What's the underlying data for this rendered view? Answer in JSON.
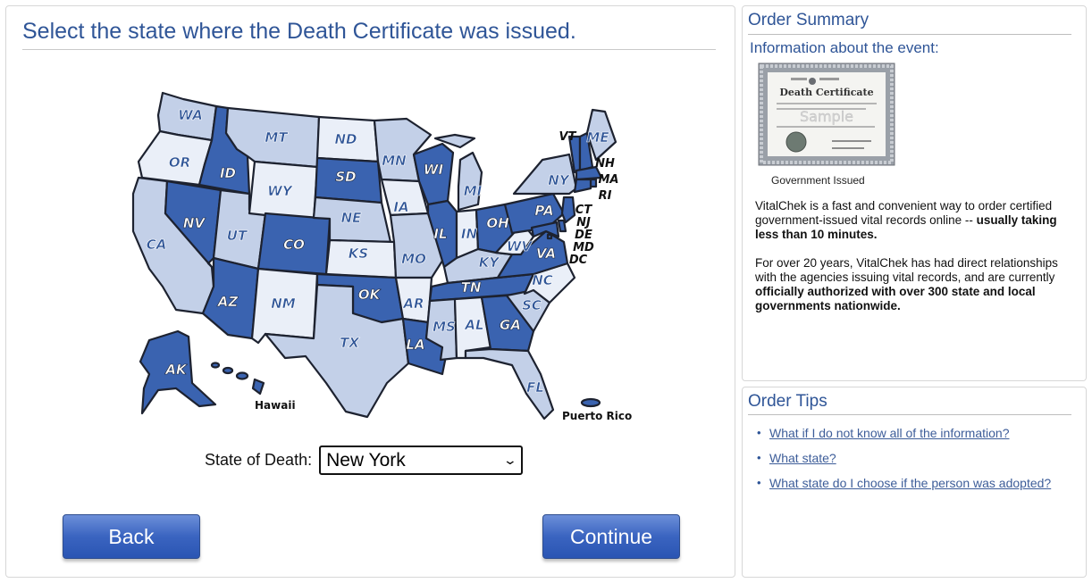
{
  "main": {
    "title": "Select the state where the Death Certificate was issued.",
    "state_label": "State of Death:",
    "state_value": "New York",
    "back_label": "Back",
    "continue_label": "Continue"
  },
  "map": {
    "colors": {
      "dark": "#3a63b0",
      "light": "#c3d0e8",
      "pale": "#eaeff8",
      "outline": "#1d2230"
    },
    "states": [
      {
        "abbr": "WA",
        "shade": "light"
      },
      {
        "abbr": "OR",
        "shade": "pale"
      },
      {
        "abbr": "CA",
        "shade": "light"
      },
      {
        "abbr": "ID",
        "shade": "dark"
      },
      {
        "abbr": "NV",
        "shade": "dark"
      },
      {
        "abbr": "MT",
        "shade": "light"
      },
      {
        "abbr": "WY",
        "shade": "pale"
      },
      {
        "abbr": "UT",
        "shade": "light"
      },
      {
        "abbr": "AZ",
        "shade": "dark"
      },
      {
        "abbr": "CO",
        "shade": "dark"
      },
      {
        "abbr": "NM",
        "shade": "pale"
      },
      {
        "abbr": "ND",
        "shade": "pale"
      },
      {
        "abbr": "SD",
        "shade": "dark"
      },
      {
        "abbr": "NE",
        "shade": "light"
      },
      {
        "abbr": "KS",
        "shade": "pale"
      },
      {
        "abbr": "OK",
        "shade": "dark"
      },
      {
        "abbr": "TX",
        "shade": "light"
      },
      {
        "abbr": "MN",
        "shade": "light"
      },
      {
        "abbr": "IA",
        "shade": "pale"
      },
      {
        "abbr": "MO",
        "shade": "light"
      },
      {
        "abbr": "AR",
        "shade": "pale"
      },
      {
        "abbr": "LA",
        "shade": "dark"
      },
      {
        "abbr": "WI",
        "shade": "dark"
      },
      {
        "abbr": "IL",
        "shade": "dark"
      },
      {
        "abbr": "MI",
        "shade": "light"
      },
      {
        "abbr": "IN",
        "shade": "pale"
      },
      {
        "abbr": "OH",
        "shade": "dark"
      },
      {
        "abbr": "KY",
        "shade": "light"
      },
      {
        "abbr": "TN",
        "shade": "dark"
      },
      {
        "abbr": "MS",
        "shade": "light"
      },
      {
        "abbr": "AL",
        "shade": "pale"
      },
      {
        "abbr": "GA",
        "shade": "dark"
      },
      {
        "abbr": "FL",
        "shade": "light"
      },
      {
        "abbr": "SC",
        "shade": "light"
      },
      {
        "abbr": "NC",
        "shade": "pale"
      },
      {
        "abbr": "VA",
        "shade": "dark"
      },
      {
        "abbr": "WV",
        "shade": "pale"
      },
      {
        "abbr": "PA",
        "shade": "dark"
      },
      {
        "abbr": "NY",
        "shade": "light"
      },
      {
        "abbr": "VT",
        "shade": "dark"
      },
      {
        "abbr": "ME",
        "shade": "light"
      },
      {
        "abbr": "NH",
        "shade": "dark"
      },
      {
        "abbr": "MA",
        "shade": "dark"
      },
      {
        "abbr": "RI",
        "shade": "dark"
      },
      {
        "abbr": "CT",
        "shade": "dark"
      },
      {
        "abbr": "NJ",
        "shade": "dark"
      },
      {
        "abbr": "DE",
        "shade": "dark"
      },
      {
        "abbr": "MD",
        "shade": "dark"
      },
      {
        "abbr": "DC",
        "shade": "dark"
      },
      {
        "abbr": "AK",
        "shade": "dark"
      }
    ],
    "hawaii_label": "Hawaii",
    "puerto_rico_label": "Puerto Rico"
  },
  "summary": {
    "title": "Order Summary",
    "subtitle": "Information about the event:",
    "certificate_heading": "Death Certificate",
    "certificate_stamp": "Sample",
    "certificate_caption": "Government Issued",
    "p1_text": "VitalChek is a fast and convenient way to order certified government-issued vital records online --",
    "p1_bold": "usually taking less than 10 minutes.",
    "p2_text": "For over 20 years, VitalChek has had direct relationships with the agencies issuing vital records, and are currently",
    "p2_bold": "officially authorized with over 300 state and local governments nationwide."
  },
  "tips": {
    "title": "Order Tips",
    "links": [
      "What if I do not know all of the information?",
      "What state?",
      "What state do I choose if the person was adopted?"
    ]
  }
}
